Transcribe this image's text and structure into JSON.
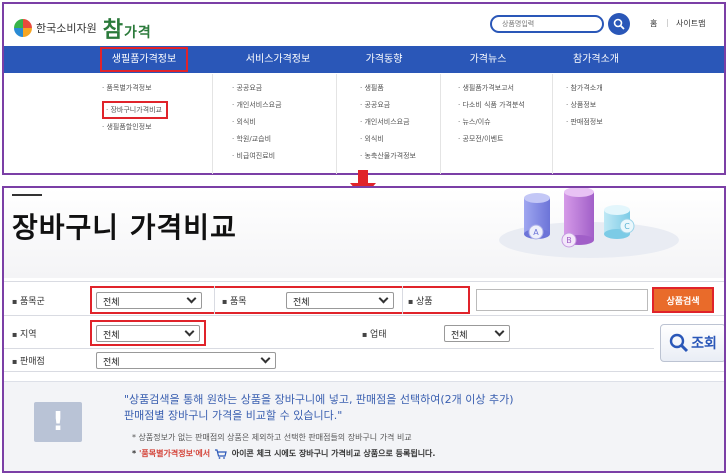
{
  "header": {
    "org_name": "한국소비자원",
    "brand": "참",
    "brand_suffix": "가격",
    "search_placeholder": "상품명입력",
    "home_label": "홈",
    "sitemap_label": "사이트맵"
  },
  "nav": {
    "items": [
      {
        "label": "생필품가격정보"
      },
      {
        "label": "서비스가격정보"
      },
      {
        "label": "가격동향"
      },
      {
        "label": "가격뉴스"
      },
      {
        "label": "참가격소개"
      }
    ]
  },
  "submenu": {
    "col1": [
      "품목별가격정보",
      "장바구니가격비교",
      "생필품할인정보"
    ],
    "col2": [
      "공공요금",
      "개인서비스요금",
      "외식비",
      "학원/교습비",
      "비급여진료비"
    ],
    "col3": [
      "생필품",
      "공공요금",
      "개인서비스요금",
      "외식비",
      "농축산물가격정보"
    ],
    "col4": [
      "생필품가격보고서",
      "다소비 식품 가격분석",
      "뉴스/이슈",
      "공모전/이벤트"
    ],
    "col5": [
      "참가격소개",
      "상품정보",
      "판매점정보"
    ]
  },
  "page": {
    "title": "장바구니 가격비교",
    "hero_letters": [
      "A",
      "B",
      "C"
    ]
  },
  "filters": {
    "category_label": "품목군",
    "category_value": "전체",
    "item_label": "품목",
    "item_value": "전체",
    "product_label": "상품",
    "product_search_label": "상품검색",
    "region_label": "지역",
    "region_value": "전체",
    "business_label": "업태",
    "business_value": "전체",
    "store_label": "판매점",
    "store_value": "전체",
    "lookup_label": "조회"
  },
  "notice": {
    "icon": "!",
    "line1": "\"상품검색을 통해 원하는 상품을 장바구니에 넣고, 판매점을 선택하여(2개 이상 추가)",
    "line2": "판매점별 장바구니 가격을 비교할 수 있습니다.\"",
    "note1": "상품정보가 없는 판매점의 상품은 제외하고 선택한 판매점들의 장바구니 가격 비교",
    "note2_prefix": "'품목별가격정보'에서",
    "note2_suffix": "아이콘 체크 시에도 장바구니 가격비교 상품으로 등록됩니다."
  },
  "colors": {
    "nav_blue": "#2a57b8",
    "highlight_red": "#e0232a",
    "frame_purple": "#7b3fa6",
    "button_orange": "#e96b2a"
  }
}
